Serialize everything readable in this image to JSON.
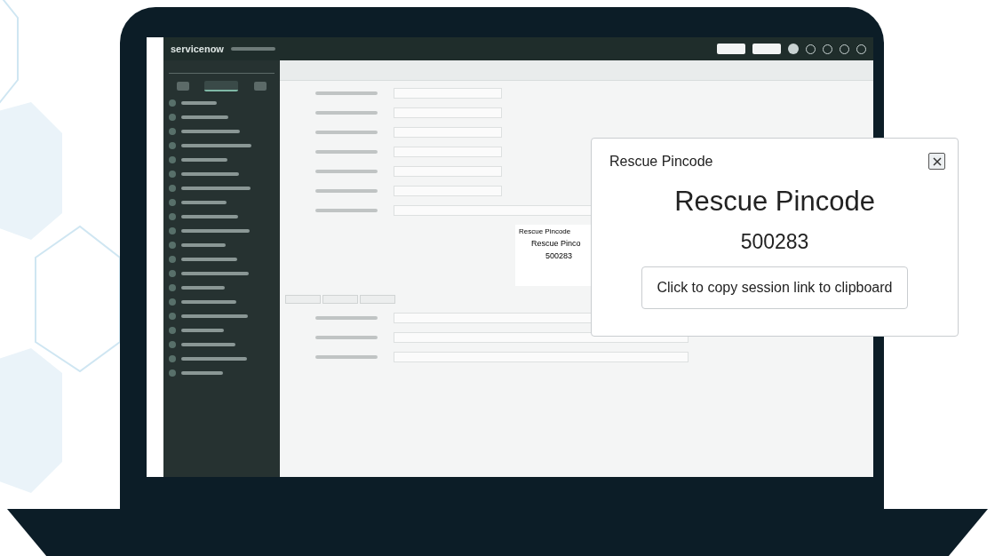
{
  "screen": {
    "logo": "servicenow"
  },
  "sidebar": {
    "tabs": [
      {
        "selected": false
      },
      {
        "selected": true
      },
      {
        "selected": false
      }
    ]
  },
  "background_popup": {
    "header": "Rescue Pincode",
    "title": "Rescue Pinco",
    "pin": "500283"
  },
  "popup": {
    "header": "Rescue Pincode",
    "title": "Rescue Pincode",
    "pin": "500283",
    "button": "Click to copy session link to clipboard"
  }
}
